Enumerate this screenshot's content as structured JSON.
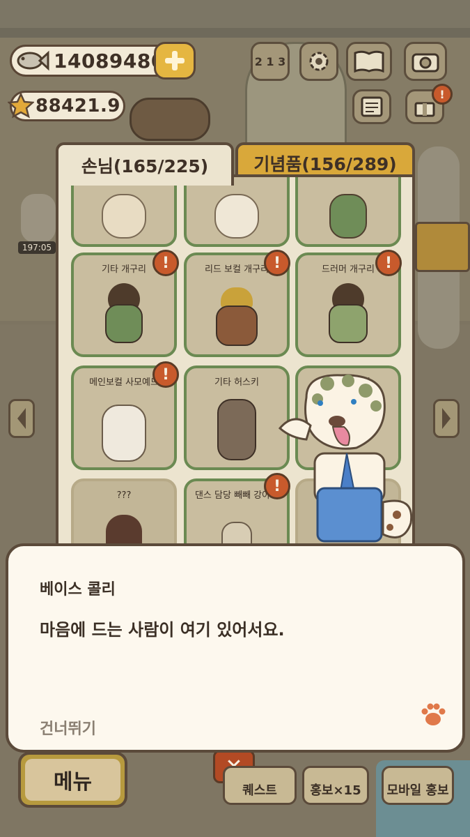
{
  "currency": {
    "fish_icon": "fish-icon",
    "fish_value": "14089480",
    "star_icon": "star-icon",
    "star_value": "88421.9"
  },
  "top_icons": [
    "ranking-icon",
    "gear-icon",
    "book-icon",
    "camera-icon",
    "newspaper-icon",
    "gift-icon"
  ],
  "timer": "197:05",
  "tabs": {
    "guests": "손님(165/225)",
    "souvenirs": "기념품(156/289)"
  },
  "cards": [
    {
      "name": "",
      "alert": false
    },
    {
      "name": "",
      "alert": false
    },
    {
      "name": "",
      "alert": false
    },
    {
      "name": "기타 개구리",
      "alert": true
    },
    {
      "name": "리드 보컬 개구리",
      "alert": true
    },
    {
      "name": "드러머 개구리",
      "alert": true
    },
    {
      "name": "메인보컬 사모예드",
      "alert": true
    },
    {
      "name": "기타 허스키",
      "alert": false
    },
    {
      "name": "베이스 콜리",
      "alert": false
    },
    {
      "name": "???",
      "alert": false
    },
    {
      "name": "댄스 담당 빼빼 강아지",
      "alert": true
    },
    {
      "name": "",
      "alert": false
    }
  ],
  "dialog": {
    "speaker": "베이스 콜리",
    "line": "마음에 드는 사람이 여기 있어서요.",
    "skip": "건너뛰기"
  },
  "bottom_bar": {
    "menu": "메뉴",
    "quest": "퀘스트",
    "promo": "홍보×15",
    "mobile_promo": "모바일 홍보"
  },
  "colors": {
    "accent_orange": "#c85a2c",
    "tab_active": "#ece4cf",
    "tab_inactive": "#d9a83a",
    "card_border": "#6b8a52"
  }
}
